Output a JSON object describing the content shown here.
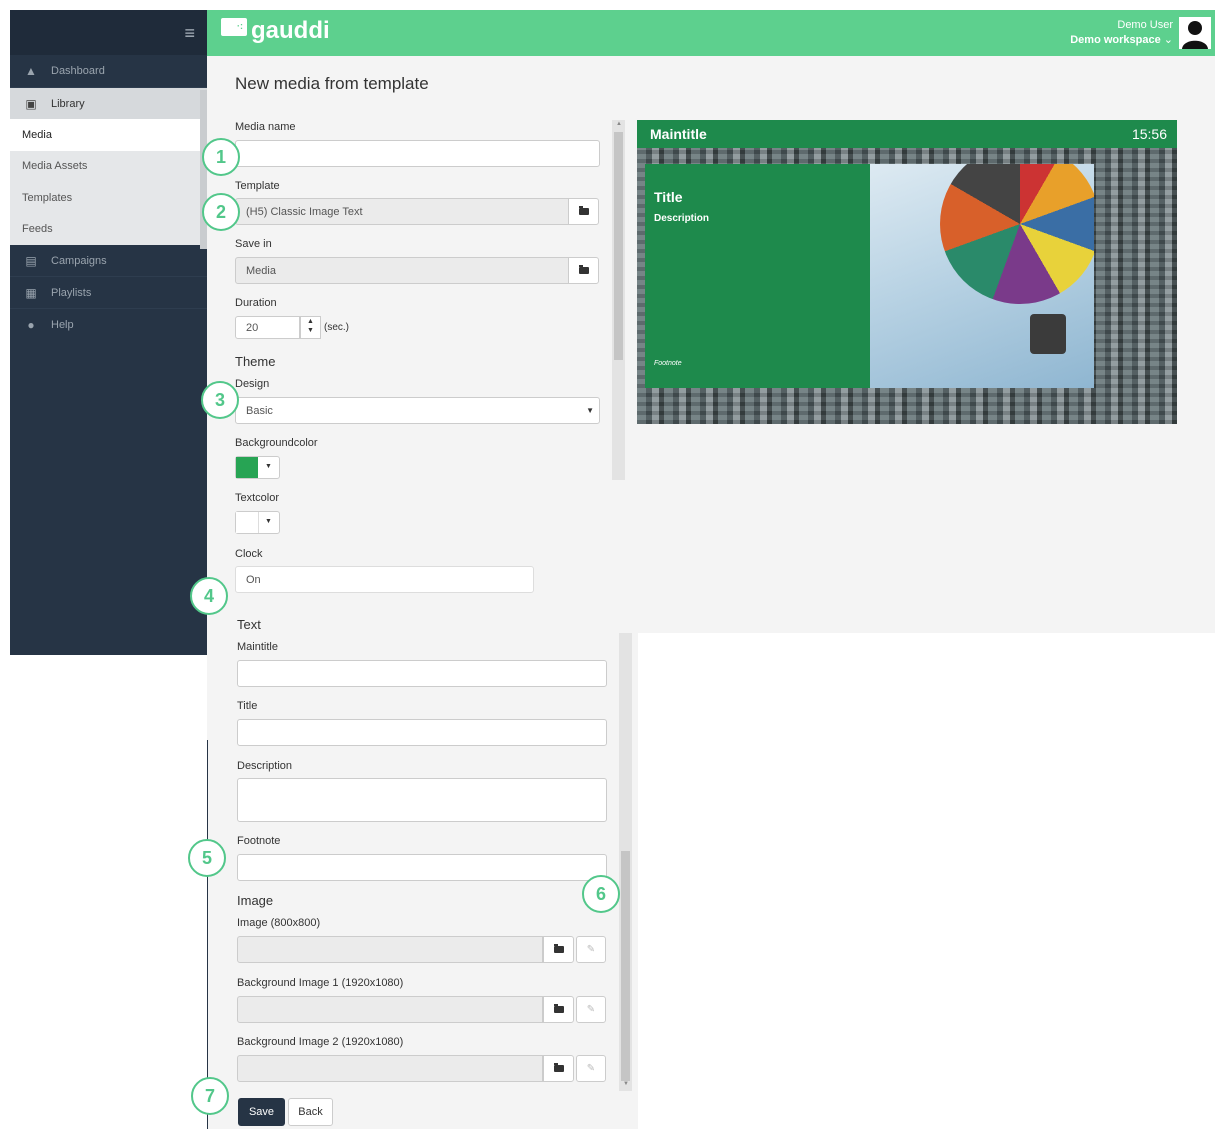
{
  "sidebar": {
    "items": [
      {
        "label": "Dashboard",
        "icon": "home-icon"
      },
      {
        "label": "Library",
        "icon": "image-icon"
      },
      {
        "label": "Campaigns",
        "icon": "clapperboard-icon"
      },
      {
        "label": "Playlists",
        "icon": "film-icon"
      },
      {
        "label": "Help",
        "icon": "question-icon"
      }
    ],
    "library_sub": [
      "Media",
      "Media Assets",
      "Templates",
      "Feeds"
    ],
    "active": "Media"
  },
  "header": {
    "brand": "gauddi",
    "user_name": "Demo User",
    "workspace": "Demo workspace",
    "workspace_caret": "⌄",
    "brand_color": "#5dd08e"
  },
  "page": {
    "title": "New media from template"
  },
  "form": {
    "media_name_label": "Media name",
    "media_name_value": "",
    "template_label": "Template",
    "template_value": "(H5) Classic Image Text",
    "save_in_label": "Save in",
    "save_in_value": "Media",
    "duration_label": "Duration",
    "duration_value": "20",
    "duration_unit": "(sec.)",
    "theme_heading": "Theme",
    "design_label": "Design",
    "design_value": "Basic",
    "bgcolor_label": "Backgroundcolor",
    "bgcolor_value": "#27a454",
    "textcolor_label": "Textcolor",
    "textcolor_value": "#ffffff",
    "clock_label": "Clock",
    "clock_value": "On",
    "text_heading": "Text",
    "maintitle_label": "Maintitle",
    "title_label": "Title",
    "description_label": "Description",
    "footnote_label": "Footnote",
    "image_heading": "Image",
    "image1_label": "Image (800x800)",
    "bg1_label": "Background Image 1 (1920x1080)",
    "bg2_label": "Background Image 2 (1920x1080)",
    "save_label": "Save",
    "back_label": "Back"
  },
  "preview": {
    "maintitle": "Maintitle",
    "clock": "15:56",
    "title": "Title",
    "description": "Description",
    "footnote": "Footnote",
    "green": "#1e8a4c"
  },
  "callouts": [
    "1",
    "2",
    "3",
    "4",
    "5",
    "6",
    "7"
  ]
}
